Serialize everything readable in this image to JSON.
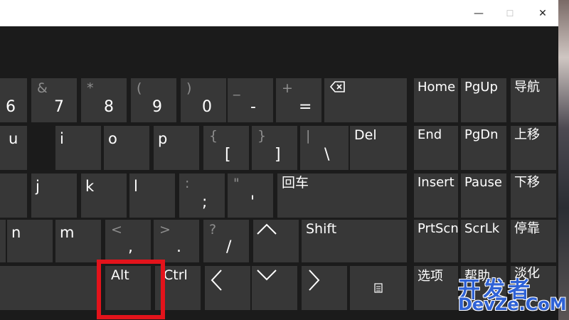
{
  "window": {
    "minimize_glyph": "—",
    "maximize_glyph": "☐",
    "close_glyph": "✕"
  },
  "keys": {
    "k6": {
      "bottom": "6"
    },
    "k7": {
      "top": "&",
      "bottom": "7"
    },
    "k8": {
      "top": "*",
      "bottom": "8"
    },
    "k9": {
      "top": "(",
      "bottom": "9"
    },
    "k0": {
      "top": ")",
      "bottom": "0"
    },
    "minus": {
      "top": "_",
      "bottom": "-"
    },
    "equals": {
      "top": "+",
      "bottom": "="
    },
    "u": "u",
    "i": "i",
    "o": "o",
    "p": "p",
    "lbracket": {
      "top": "{",
      "bottom": "["
    },
    "rbracket": {
      "top": "}",
      "bottom": "]"
    },
    "backslash": {
      "top": "|",
      "bottom": "\\"
    },
    "del": "Del",
    "j": "j",
    "k": "k",
    "l": "l",
    "semicolon": {
      "top": ":",
      "bottom": ";"
    },
    "quote": {
      "top": "\"",
      "bottom": "'"
    },
    "enter": "回车",
    "n": "n",
    "m": "m",
    "comma": {
      "top": "<",
      "bottom": ","
    },
    "period": {
      "top": ">",
      "bottom": "."
    },
    "slash": {
      "top": "?",
      "bottom": "/"
    },
    "shift": "Shift",
    "alt": "Alt",
    "ctrl": "Ctrl",
    "home": "Home",
    "pgup": "PgUp",
    "nav": "导航",
    "end": "End",
    "pgdn": "PgDn",
    "moveup": "上移",
    "insert": "Insert",
    "pause": "Pause",
    "movedown": "下移",
    "prtscn": "PrtScn",
    "scrlk": "ScrLk",
    "dock": "停靠",
    "options": "选项",
    "help": "帮助",
    "fade": "淡化"
  },
  "watermark": {
    "cn": "开发者",
    "en": "DevZe.CoM"
  },
  "colors": {
    "key_bg": "#373737",
    "keyboard_bg": "#1b1b1b",
    "highlight": "#e3131b",
    "watermark": "#2f62d6"
  },
  "icons": [
    "backspace-icon",
    "arrow-up-icon",
    "arrow-left-icon",
    "arrow-down-icon",
    "arrow-right-icon",
    "menu-icon"
  ]
}
